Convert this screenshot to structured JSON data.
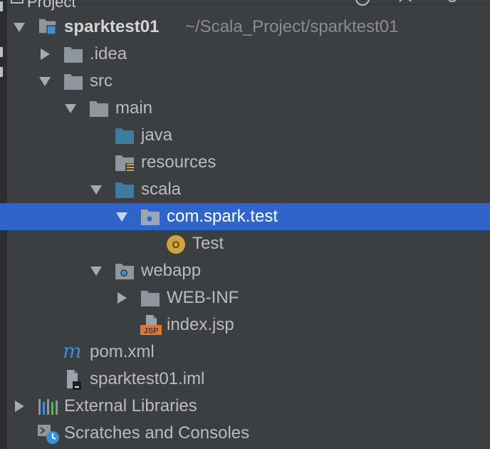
{
  "header": {
    "title": "Project"
  },
  "tree": {
    "root": {
      "label": "sparktest01",
      "path": "~/Scala_Project/sparktest01"
    },
    "idea": {
      "label": ".idea"
    },
    "src": {
      "label": "src"
    },
    "main": {
      "label": "main"
    },
    "java": {
      "label": "java"
    },
    "resources": {
      "label": "resources"
    },
    "scala": {
      "label": "scala"
    },
    "package": {
      "label": "com.spark.test"
    },
    "test_object": {
      "label": "Test"
    },
    "webapp": {
      "label": "webapp"
    },
    "webinf": {
      "label": "WEB-INF"
    },
    "indexjsp": {
      "label": "index.jsp",
      "badge": "JSP"
    },
    "pom": {
      "label": "pom.xml",
      "glyph": "m"
    },
    "iml": {
      "label": "sparktest01.iml"
    },
    "external_libraries": {
      "label": "External Libraries"
    },
    "scratches": {
      "label": "Scratches and Consoles"
    },
    "test_object_glyph": "O"
  },
  "colors": {
    "background": "#3c3f41",
    "selection": "#2f65ca",
    "folder": "#8f979e",
    "source_folder": "#3d7ca0",
    "scala_object": "#d3a240",
    "jsp_badge": "#e0762f",
    "maven": "#3a8fd6"
  }
}
